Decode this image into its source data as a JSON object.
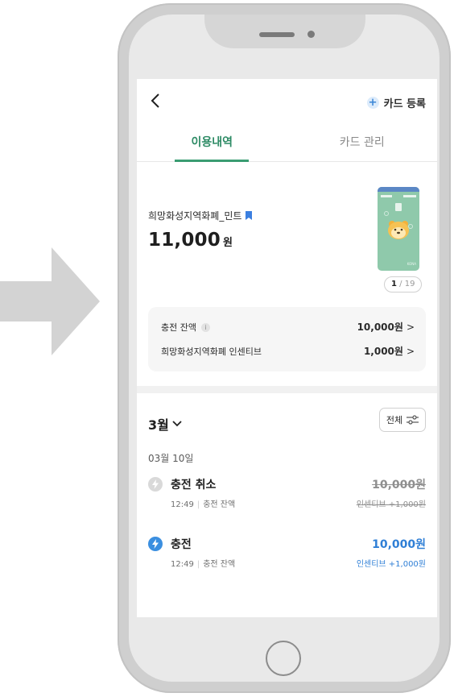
{
  "header": {
    "card_register": "카드 등록"
  },
  "tabs": [
    {
      "label": "이용내역",
      "active": true
    },
    {
      "label": "카드 관리",
      "active": false
    }
  ],
  "card": {
    "name": "희망화성지역화폐_민트",
    "amount": "11,000",
    "currency": "원",
    "page_current": "1",
    "page_total": "19",
    "brand_text": "KONA"
  },
  "balances": [
    {
      "label": "충전 잔액",
      "value": "10,000원"
    },
    {
      "label": "희망화성지역화폐 인센티브",
      "value": "1,000원"
    }
  ],
  "history": {
    "month": "3월",
    "filter_label": "전체",
    "date": "03월 10일",
    "transactions": [
      {
        "title": "충전 취소",
        "time": "12:49",
        "source": "충전 잔액",
        "amount": "10,000원",
        "note": "인센티브 +1,000원",
        "cancelled": true
      },
      {
        "title": "충전",
        "time": "12:49",
        "source": "충전 잔액",
        "amount": "10,000원",
        "note": "인센티브 +1,000원",
        "cancelled": false
      }
    ]
  },
  "colors": {
    "accent_green": "#2c8a64",
    "accent_blue": "#2f7fd6",
    "phone_frame": "#cfcfcf"
  }
}
